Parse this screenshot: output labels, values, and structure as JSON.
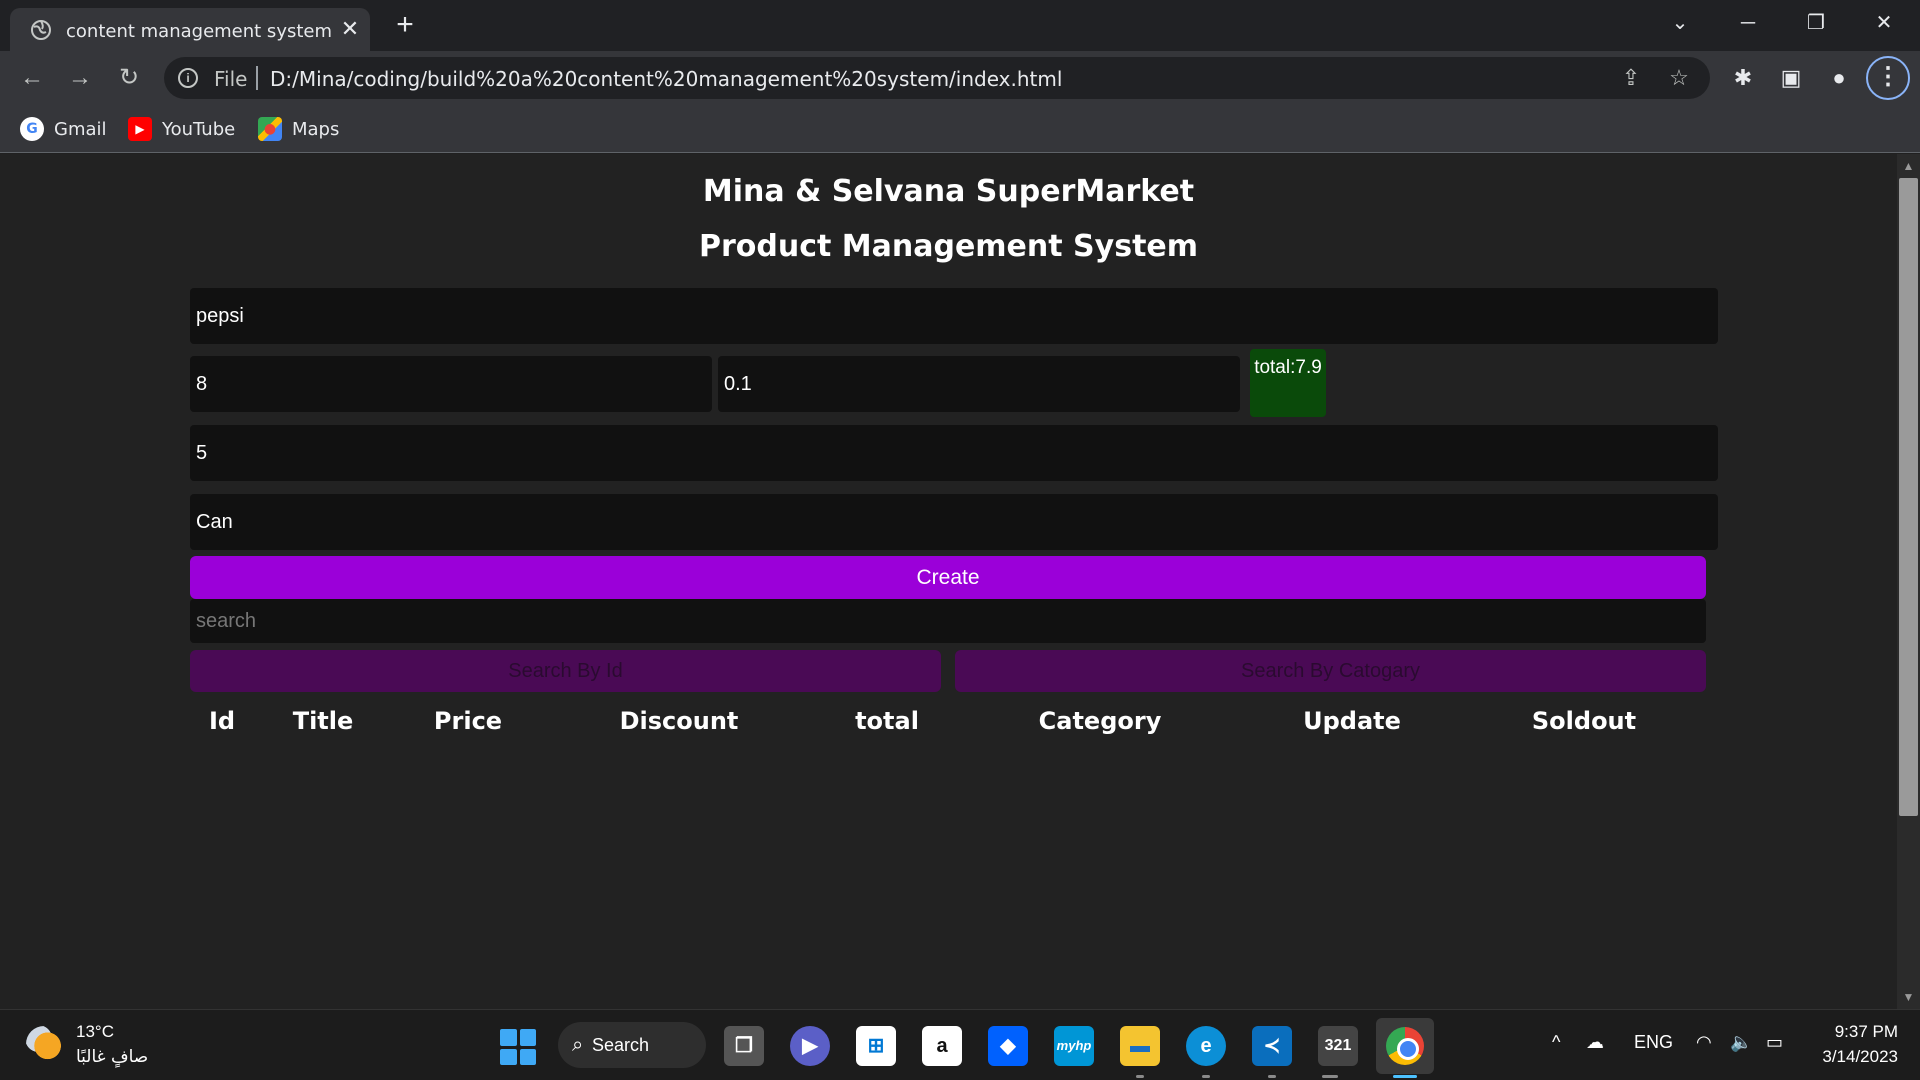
{
  "browser": {
    "tab_title": "content management system",
    "address_scheme": "File",
    "url": "D:/Mina/coding/build%20a%20content%20management%20system/index.html",
    "bookmarks": [
      {
        "label": "Gmail",
        "icon": "google-icon"
      },
      {
        "label": "YouTube",
        "icon": "youtube-icon"
      },
      {
        "label": "Maps",
        "icon": "maps-icon"
      }
    ]
  },
  "page": {
    "heading": "Mina & Selvana SuperMarket",
    "subheading": "Product Management System",
    "form": {
      "title_value": "pepsi",
      "price_value": "8",
      "discount_value": "0.1",
      "total_label": "total:7.9",
      "count_value": "5",
      "category_value": "Can"
    },
    "create_label": "Create",
    "search_placeholder": "search",
    "search_by_id_label": "Search By Id",
    "search_by_category_label": "Search By Catogary",
    "table_headers": [
      "Id",
      "Title",
      "Price",
      "Discount",
      "total",
      "Category",
      "Update",
      "Soldout"
    ],
    "accent_colors": {
      "create": "#9b00d9",
      "total": "#0a4a0a",
      "search_buttons": "#4a0a55"
    }
  },
  "taskbar": {
    "weather_temp": "13°C",
    "weather_desc": "صافٍ غالبًا",
    "search_label": "Search",
    "language": "ENG",
    "time": "9:37 PM",
    "date": "3/14/2023"
  }
}
